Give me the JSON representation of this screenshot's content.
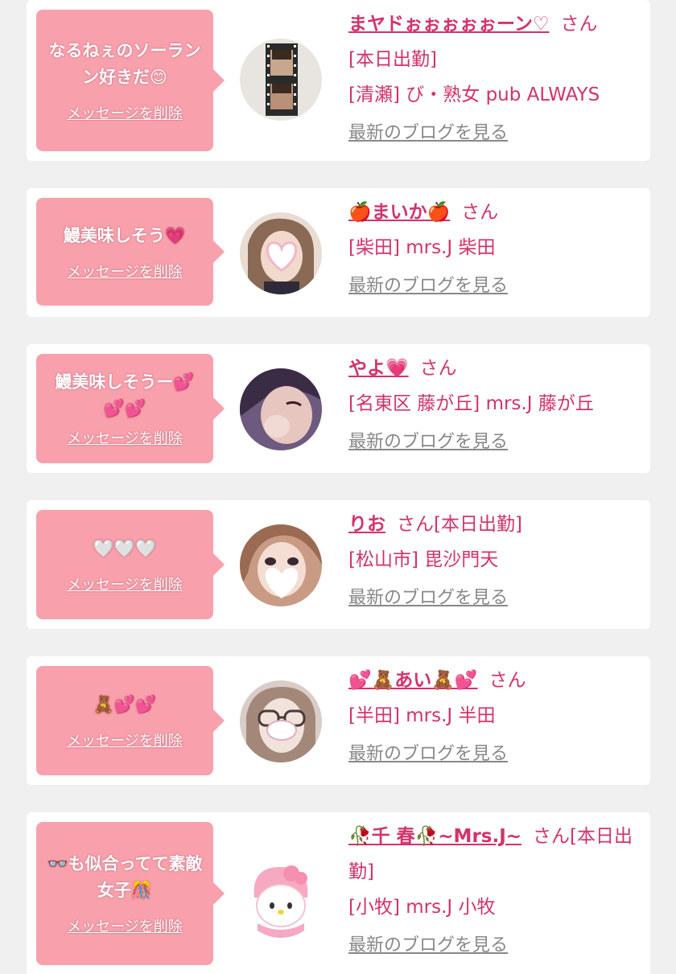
{
  "delete_label": "メッセージを削除",
  "blog_label": "最新のブログを見る",
  "colors": {
    "accent": "#d4326a",
    "bubble": "#f9a0ad",
    "background": "#f0f0f0"
  },
  "cards": [
    {
      "message": "なるねぇのソーランン好きだ😊",
      "name": "まヤドぉぉぉぉぉーン♡",
      "suffix": "さん",
      "status": "[本日出勤]",
      "shop": "[清瀬] び・熟女 pub ALWAYS",
      "avatar_icon": "photo-strip-avatar-icon"
    },
    {
      "message": "鰻美味しそう💗",
      "name": "🍎まいか🍎",
      "suffix": "さん",
      "status": "",
      "shop": "[柴田] mrs.J 柴田",
      "avatar_icon": "heart-face-avatar-icon"
    },
    {
      "message": "鰻美味しそうー💕💕💕",
      "name": "やよ💗",
      "suffix": "さん",
      "status": "",
      "shop": "[名東区 藤が丘] mrs.J 藤が丘",
      "avatar_icon": "wink-avatar-icon"
    },
    {
      "message": "🤍🤍🤍",
      "name": "りお",
      "suffix": "さん[本日出勤]",
      "status": "",
      "shop": "[松山市] 毘沙門天",
      "avatar_icon": "heart-face-avatar-icon"
    },
    {
      "message": "🧸💕💕",
      "name": "💕🧸あい🧸💕",
      "suffix": "さん",
      "status": "",
      "shop": "[半田] mrs.J 半田",
      "avatar_icon": "glasses-avatar-icon"
    },
    {
      "message": "👓も似合ってて素敵女子🎊",
      "name": "🥀千 春🥀~Mrs.J~",
      "suffix": "さん[本日出勤]",
      "status": "",
      "shop": "[小牧] mrs.J 小牧",
      "avatar_icon": "plush-toy-avatar-icon"
    }
  ]
}
